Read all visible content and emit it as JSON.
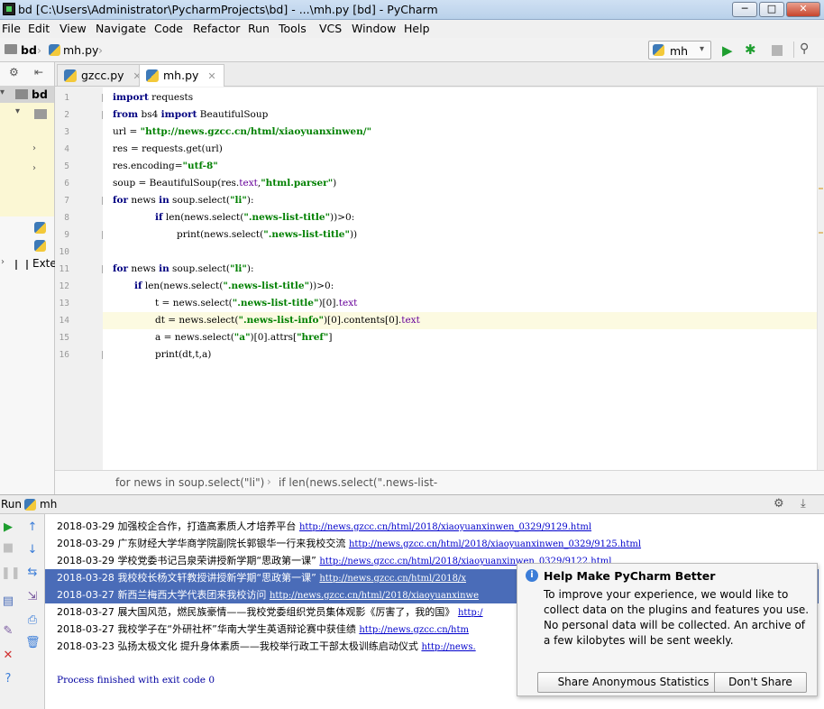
{
  "window": {
    "title": "bd [C:\\Users\\Administrator\\PycharmProjects\\bd] - ...\\mh.py [bd] - PyCharm",
    "minimize": "─",
    "maximize": "□",
    "close": "✕"
  },
  "menu": [
    "File",
    "Edit",
    "View",
    "Navigate",
    "Code",
    "Refactor",
    "Run",
    "Tools",
    "VCS",
    "Window",
    "Help"
  ],
  "nav": {
    "project": "bd",
    "file": "mh.py",
    "run_config": "mh"
  },
  "project_panel": {
    "root": "bd",
    "external": "Exte"
  },
  "tabs": [
    {
      "label": "gzcc.py",
      "active": false
    },
    {
      "label": "mh.py",
      "active": true
    }
  ],
  "code_lines": [
    {
      "n": "1"
    },
    {
      "n": "2"
    },
    {
      "n": "3"
    },
    {
      "n": "4"
    },
    {
      "n": "5"
    },
    {
      "n": "6"
    },
    {
      "n": "7"
    },
    {
      "n": "8"
    },
    {
      "n": "9"
    },
    {
      "n": "10"
    },
    {
      "n": "11"
    },
    {
      "n": "12"
    },
    {
      "n": "13"
    },
    {
      "n": "14"
    },
    {
      "n": "15"
    },
    {
      "n": "16"
    }
  ],
  "code": {
    "l1_kw": "import",
    "l1_rest": " requests",
    "l2_kw1": "from",
    "l2_mid": " bs4 ",
    "l2_kw2": "import",
    "l2_rest": " BeautifulSoup",
    "l3_pre": "url = ",
    "l3_str": "\"http://news.gzcc.cn/html/xiaoyuanxinwen/\"",
    "l4": "res = requests.get(url)",
    "l5_pre": "res.encoding=",
    "l5_str": "\"utf-8\"",
    "l6_pre": "soup = BeautifulSoup(res.",
    "l6_attr": "text",
    "l6_mid": ",",
    "l6_str": "\"html.parser\"",
    "l6_end": ")",
    "l7_kw1": "for",
    "l7_mid": " news ",
    "l7_kw2": "in",
    "l7_pre": " soup.select(",
    "l7_str": "\"li\"",
    "l7_end": "):",
    "l8_kw": "if",
    "l8_pre": " len(news.select(",
    "l8_str": "\".news-list-title\"",
    "l8_end": "))>0:",
    "l9_pre": "print(news.select(",
    "l9_str": "\".news-list-title\"",
    "l9_end": "))",
    "l11_kw1": "for",
    "l11_mid": " news ",
    "l11_kw2": "in",
    "l11_pre": " soup.select(",
    "l11_str": "\"li\"",
    "l11_end": "):",
    "l12_kw": "if",
    "l12_pre": " len(news.select(",
    "l12_str": "\".news-list-title\"",
    "l12_end": "))>0:",
    "l13_pre": "t = news.select(",
    "l13_str": "\".news-list-title\"",
    "l13_mid": ")[0].",
    "l13_attr": "text",
    "l14_pre": "dt = news.select(",
    "l14_str": "\".news-list-info\"",
    "l14_mid": ")[0].contents[0].",
    "l14_attr": "text",
    "l15_pre": "a = news.select(",
    "l15_str": "\"a\"",
    "l15_mid": ")[0].attrs[",
    "l15_str2": "\"href\"",
    "l15_end": "]",
    "l16": "print(dt,t,a)"
  },
  "breadcrumb": {
    "part1": "for news in soup.select(\"li\")",
    "part2": "if len(news.select(\".news-list-"
  },
  "run": {
    "label": "Run",
    "config": "mh",
    "process": "Process finished with exit code 0"
  },
  "console_lines": [
    {
      "date": "2018-03-29",
      "text": "加强校企合作，打造高素质人才培养平台",
      "link": "http://news.gzcc.cn/html/2018/xiaoyuanxinwen_0329/9129.html",
      "selected": false
    },
    {
      "date": "2018-03-29",
      "text": "广东财经大学华商学院副院长郭银华一行来我校交流",
      "link": "http://news.gzcc.cn/html/2018/xiaoyuanxinwen_0329/9125.html",
      "selected": false
    },
    {
      "date": "2018-03-29",
      "text": "学校党委书记吕泉荣讲授新学期“思政第一课”",
      "link": "http://news.gzcc.cn/html/2018/xiaoyuanxinwen_0329/9122.html",
      "selected": false
    },
    {
      "date": "2018-03-28",
      "text": "我校校长杨文轩教授讲授新学期“思政第一课”",
      "link": "http://news.gzcc.cn/html/2018/x",
      "selected": true
    },
    {
      "date": "2018-03-27",
      "text": "新西兰梅西大学代表团来我校访问",
      "link": "http://news.gzcc.cn/html/2018/xiaoyuanxinwe",
      "selected": true
    },
    {
      "date": "2018-03-27",
      "text": "展大国风范，燃民族豪情——我校党委组织党员集体观影《厉害了，我的国》",
      "link": "http:/",
      "selected": false
    },
    {
      "date": "2018-03-27",
      "text": "我校学子在“外研社杯”华南大学生英语辩论赛中获佳绩",
      "link": "http://news.gzcc.cn/htm",
      "selected": false
    },
    {
      "date": "2018-03-23",
      "text": "弘扬太极文化 提升身体素质——我校举行政工干部太极训练启动仪式",
      "link": "http://news.",
      "selected": false
    }
  ],
  "notification": {
    "title": "Help Make PyCharm Better",
    "body": "To improve your experience, we would like to collect data on the plugins and features you use. No personal data will be collected. An archive of a few kilobytes will be sent weekly.",
    "share_button": "Share Anonymous Statistics",
    "dont_share_button": "Don't Share"
  },
  "colors": {
    "keyword": "#000080",
    "string": "#008000",
    "attribute": "#660099",
    "selection": "#4a6cb8",
    "link": "#0000cc"
  }
}
